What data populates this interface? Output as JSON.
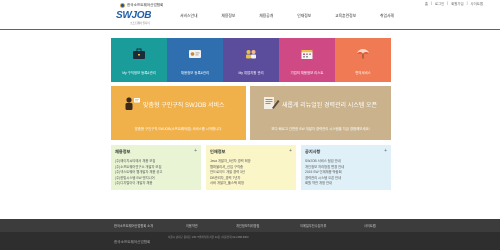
{
  "header": {
    "org_name": "한국소프트웨어산업협회",
    "logo_main": "SWJOB",
    "logo_sub": "소프트웨어 일자리",
    "util_links": [
      "홈",
      "로그인",
      "회원가입",
      "사이트맵"
    ],
    "nav": [
      "서비스안내",
      "채용정보",
      "채용공개",
      "인재정보",
      "교육훈련정보",
      "취업사례"
    ]
  },
  "tiles": [
    {
      "label": "My 구직정보 등록&관리",
      "color": "#1a9d9a",
      "icon": "briefcase-icon"
    },
    {
      "label": "채용정보 등록&관리",
      "color": "#2f6fb0",
      "icon": "id-card-icon"
    },
    {
      "label": "My 취업지원 관리",
      "color": "#5b4c9c",
      "icon": "users-icon"
    },
    {
      "label": "기업의 채용정보 리스트",
      "color": "#cf4a85",
      "icon": "calendar-icon"
    },
    {
      "label": "편의서비스",
      "color": "#f07a54",
      "icon": "umbrella-icon"
    }
  ],
  "promos": [
    {
      "title": "맞춤형 구인구직 SWJOB 서비스",
      "sub": "맞춤형 구인구직 SWJOB(소프트웨어잡) 서비스를 시작합니다.",
      "color": "#f0b04a"
    },
    {
      "title": "새롭게 리뉴얼된 경력관리 시스템 오픈",
      "sub": "보다 빠르고 간편한 SW 개발자 경력관리 시스템을 지금 경험해보세요!",
      "color": "#c9b28c"
    }
  ],
  "boards": [
    {
      "title": "채용정보",
      "color": "#e8f4d4",
      "items": [
        "(주)에이치씨티에서 채용 모집",
        "(주)소프트웨어연구소 개발자 모집",
        "(주)넥스트웨어 웹개발자 채용 공고",
        "(주)한빛시스템 SW 엔지니어",
        "(주)디지털아이 개발자 채용"
      ]
    },
    {
      "title": "인재정보",
      "color": "#fbf6c8",
      "items": [
        "Java 개발자_5년차 경력 희망",
        "웹퍼블리셔_신입 구직중",
        "안드로이드 개발 경력 3년",
        "DB관리자_경력 7년차",
        "서버 개발자_풀스택 희망"
      ]
    },
    {
      "title": "공지사항",
      "color": "#dff0f8",
      "items": [
        "SWJOB 서비스 점검 안내",
        "개인정보 처리방침 변경 안내",
        "2015 SW 인재채용 박람회",
        "경력관리 시스템 오픈 안내",
        "회원 약관 개정 안내"
      ]
    }
  ],
  "footer": {
    "links": [
      "한국소프트웨어산업협회 소개",
      "이용약관",
      "개인정보처리방침",
      "이메일무단수집거부",
      "사이트맵"
    ],
    "org": "한국소프트웨어산업협회",
    "address": "서울시 송파구 중대로 135 IT벤처타워 서관 12층 | 대표전화 02-2188-6900"
  }
}
